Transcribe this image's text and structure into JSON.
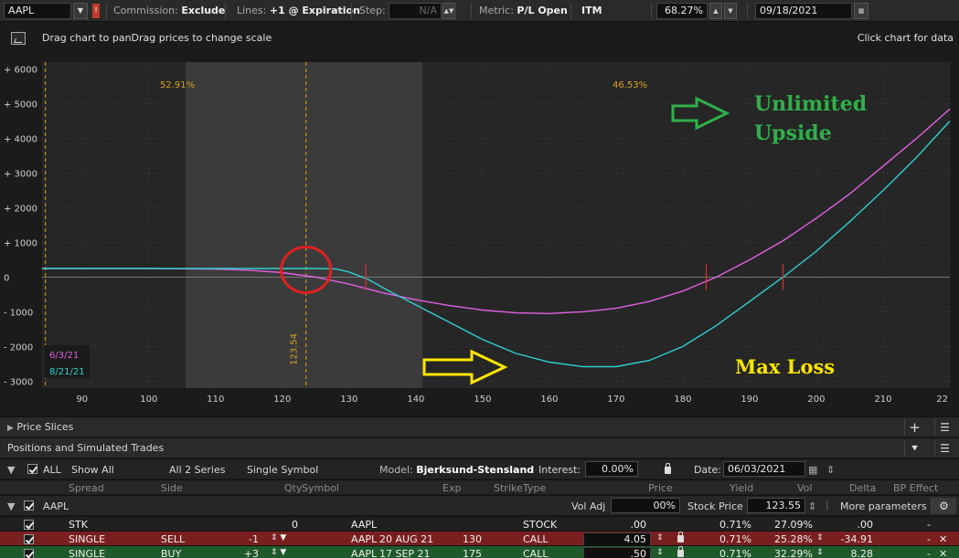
{
  "toolbar": {
    "symbol": "AAPL",
    "commission_label": "Commission:",
    "commission_value": "Exclude",
    "lines_label": "Lines:",
    "lines_value": "+1 @ Expiration",
    "step_label": "Step:",
    "step_value": "N/A",
    "metric_label": "Metric:",
    "metric_value": "P/L Open",
    "itm_label": "ITM",
    "percent_value": "68.27%",
    "date_value": "09/18/2021"
  },
  "chart_header": {
    "hint_left": "Drag chart to panDrag prices to change scale",
    "hint_right": "Click chart for data"
  },
  "chart_data": {
    "type": "line",
    "x_ticks": [
      90,
      100,
      110,
      120,
      130,
      140,
      150,
      160,
      170,
      180,
      190,
      200,
      210,
      22
    ],
    "y_ticks": [
      "+ 6000",
      "+ 5000",
      "+ 4000",
      "+ 3000",
      "+ 2000",
      "+ 1000",
      "0",
      "- 1000",
      "- 2000",
      "- 3000"
    ],
    "y_tick_values": [
      6000,
      5000,
      4000,
      3000,
      2000,
      1000,
      0,
      -1000,
      -2000,
      -3000
    ],
    "xlim": [
      84,
      220
    ],
    "ylim": [
      -3200,
      6200
    ],
    "shaded_range": [
      105.5,
      141
    ],
    "current_price": 123.54,
    "current_price_label": "123.54",
    "left_marker": 84.5,
    "prob_labels": [
      "52.91%",
      "46.53%"
    ],
    "series": [
      {
        "name": "6/3/21",
        "color": "#e060e0",
        "x": [
          84,
          100,
          110,
          115,
          120,
          125,
          130,
          135,
          140,
          145,
          150,
          155,
          160,
          165,
          170,
          175,
          180,
          185,
          190,
          195,
          200,
          205,
          210,
          215,
          220
        ],
        "y": [
          250,
          250,
          230,
          200,
          130,
          0,
          -200,
          -450,
          -650,
          -820,
          -950,
          -1030,
          -1050,
          -1000,
          -900,
          -700,
          -400,
          0,
          500,
          1050,
          1700,
          2400,
          3200,
          4000,
          4850
        ]
      },
      {
        "name": "8/21/21",
        "color": "#30d0d0",
        "x": [
          84,
          100,
          110,
          120,
          125,
          128,
          130,
          133,
          136,
          140,
          145,
          150,
          155,
          160,
          165,
          170,
          175,
          180,
          185,
          190,
          195,
          200,
          205,
          210,
          215,
          220
        ],
        "y": [
          250,
          250,
          250,
          250,
          250,
          240,
          150,
          -80,
          -400,
          -800,
          -1300,
          -1800,
          -2200,
          -2450,
          -2580,
          -2580,
          -2400,
          -2000,
          -1400,
          -700,
          0,
          750,
          1600,
          2500,
          3450,
          4500
        ]
      }
    ],
    "breakevens": [
      {
        "x": 132.5,
        "color": "#e03030"
      },
      {
        "x": 183.5,
        "color": "#e03030"
      },
      {
        "x": 195.0,
        "color": "#e03030"
      }
    ],
    "annotations": {
      "upside_line1": "Unlimited",
      "upside_line2": "Upside",
      "max_loss": "Max Loss",
      "green_color": "#2fb04a",
      "yellow_color": "#ffe600",
      "red_color": "#e02020"
    }
  },
  "panels": {
    "price_slices": "Price Slices",
    "positions": "Positions and Simulated Trades"
  },
  "filters": {
    "all": "ALL",
    "show_all": "Show All",
    "series": "All 2 Series",
    "symbol_mode": "Single Symbol",
    "model_label": "Model:",
    "model_value": "Bjerksund-Stensland",
    "interest_label": "Interest:",
    "interest_value": "0.00%",
    "date_label": "Date:",
    "date_value": "06/03/2021"
  },
  "columns": {
    "spread": "Spread",
    "side": "Side",
    "qty": "Qty",
    "symbol": "Symbol",
    "exp": "Exp",
    "strike": "Strike",
    "type": "Type",
    "price": "Price",
    "yield": "Yield",
    "vol": "Vol",
    "delta": "Delta",
    "bp": "BP Effect"
  },
  "group": {
    "symbol": "AAPL",
    "vol_adj_label": "Vol Adj",
    "vol_adj_value": "00%",
    "stock_price_label": "Stock Price",
    "stock_price_value": "123.55",
    "more": "More parameters"
  },
  "rows": [
    {
      "spread": "STK",
      "side": "",
      "qty": "0",
      "symbol": "AAPL",
      "exp": "",
      "strike": "",
      "type": "STOCK",
      "price": ".00",
      "yield": "0.71%",
      "vol": "27.09%",
      "delta": ".00",
      "bp": "-"
    },
    {
      "spread": "SINGLE",
      "side": "SELL",
      "qty": "-1",
      "symbol": "AAPL",
      "exp": "20 AUG 21",
      "strike": "130",
      "type": "CALL",
      "price": "4.05",
      "yield": "0.71%",
      "vol": "25.28%",
      "delta": "-34.91",
      "bp": "-"
    },
    {
      "spread": "SINGLE",
      "side": "BUY",
      "qty": "+3",
      "symbol": "AAPL",
      "exp": "17 SEP 21",
      "strike": "175",
      "type": "CALL",
      "price": ".50",
      "yield": "0.71%",
      "vol": "32.29%",
      "delta": "8.28",
      "bp": "-"
    }
  ]
}
